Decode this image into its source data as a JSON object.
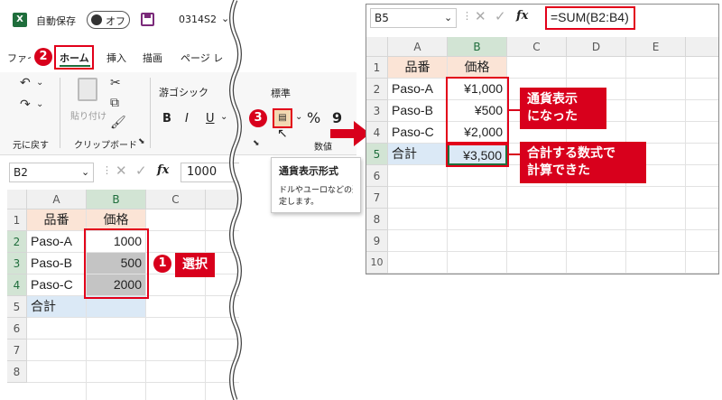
{
  "left_window": {
    "title_bar": {
      "app_icon": "excel-icon",
      "autosave_label": "自動保存",
      "toggle_label": "オフ",
      "filename": "0314S2"
    },
    "ribbon_tabs": [
      "ファイル",
      "ホーム",
      "挿入",
      "描画",
      "ページ レ"
    ],
    "active_tab": "ホーム",
    "ribbon": {
      "undo_group_label": "元に戻す",
      "clipboard_label": "クリップボード",
      "paste_label": "貼り付け",
      "font_name": "游ゴシック",
      "bold": "B",
      "italic": "I",
      "underline": "U",
      "number_format": "標準",
      "number_group_label": "数値",
      "percent": "%",
      "comma": "9"
    },
    "tooltip": {
      "title": "通貨表示形式",
      "line1": "ドルやユーロなどの通",
      "line2": "定します。"
    },
    "name_box": "B2",
    "formula_value": "1000",
    "columns": [
      "A",
      "B",
      "C"
    ],
    "rows": [
      {
        "num": "1",
        "a": "品番",
        "b": "価格"
      },
      {
        "num": "2",
        "a": "Paso-A",
        "b": "1000"
      },
      {
        "num": "3",
        "a": "Paso-B",
        "b": "500"
      },
      {
        "num": "4",
        "a": "Paso-C",
        "b": "2000"
      },
      {
        "num": "5",
        "a": "合計",
        "b": ""
      },
      {
        "num": "6",
        "a": "",
        "b": ""
      },
      {
        "num": "7",
        "a": "",
        "b": ""
      },
      {
        "num": "8",
        "a": "",
        "b": ""
      }
    ]
  },
  "right_window": {
    "name_box": "B5",
    "formula": "=SUM(B2:B4)",
    "columns": [
      "A",
      "B",
      "C",
      "D",
      "E"
    ],
    "rows": [
      {
        "num": "1",
        "a": "品番",
        "b": "価格"
      },
      {
        "num": "2",
        "a": "Paso-A",
        "b": "¥1,000"
      },
      {
        "num": "3",
        "a": "Paso-B",
        "b": "¥500"
      },
      {
        "num": "4",
        "a": "Paso-C",
        "b": "¥2,000"
      },
      {
        "num": "5",
        "a": "合計",
        "b": "¥3,500"
      },
      {
        "num": "6",
        "a": "",
        "b": ""
      },
      {
        "num": "7",
        "a": "",
        "b": ""
      },
      {
        "num": "8",
        "a": "",
        "b": ""
      },
      {
        "num": "9",
        "a": "",
        "b": ""
      },
      {
        "num": "10",
        "a": "",
        "b": ""
      }
    ]
  },
  "annotations": {
    "step1_num": "1",
    "step1_label": "選択",
    "step2_num": "2",
    "step3_num": "3",
    "callout_currency_line1": "通貨表示",
    "callout_currency_line2": "になった",
    "callout_sum_line1": "合計する数式で",
    "callout_sum_line2": "計算できた"
  },
  "colors": {
    "accent_red": "#d8001c",
    "header_fill": "#fbe4d6",
    "total_fill": "#dbe9f6",
    "selection_gray": "#c4c4c4",
    "excel_green": "#1f6e3c"
  }
}
